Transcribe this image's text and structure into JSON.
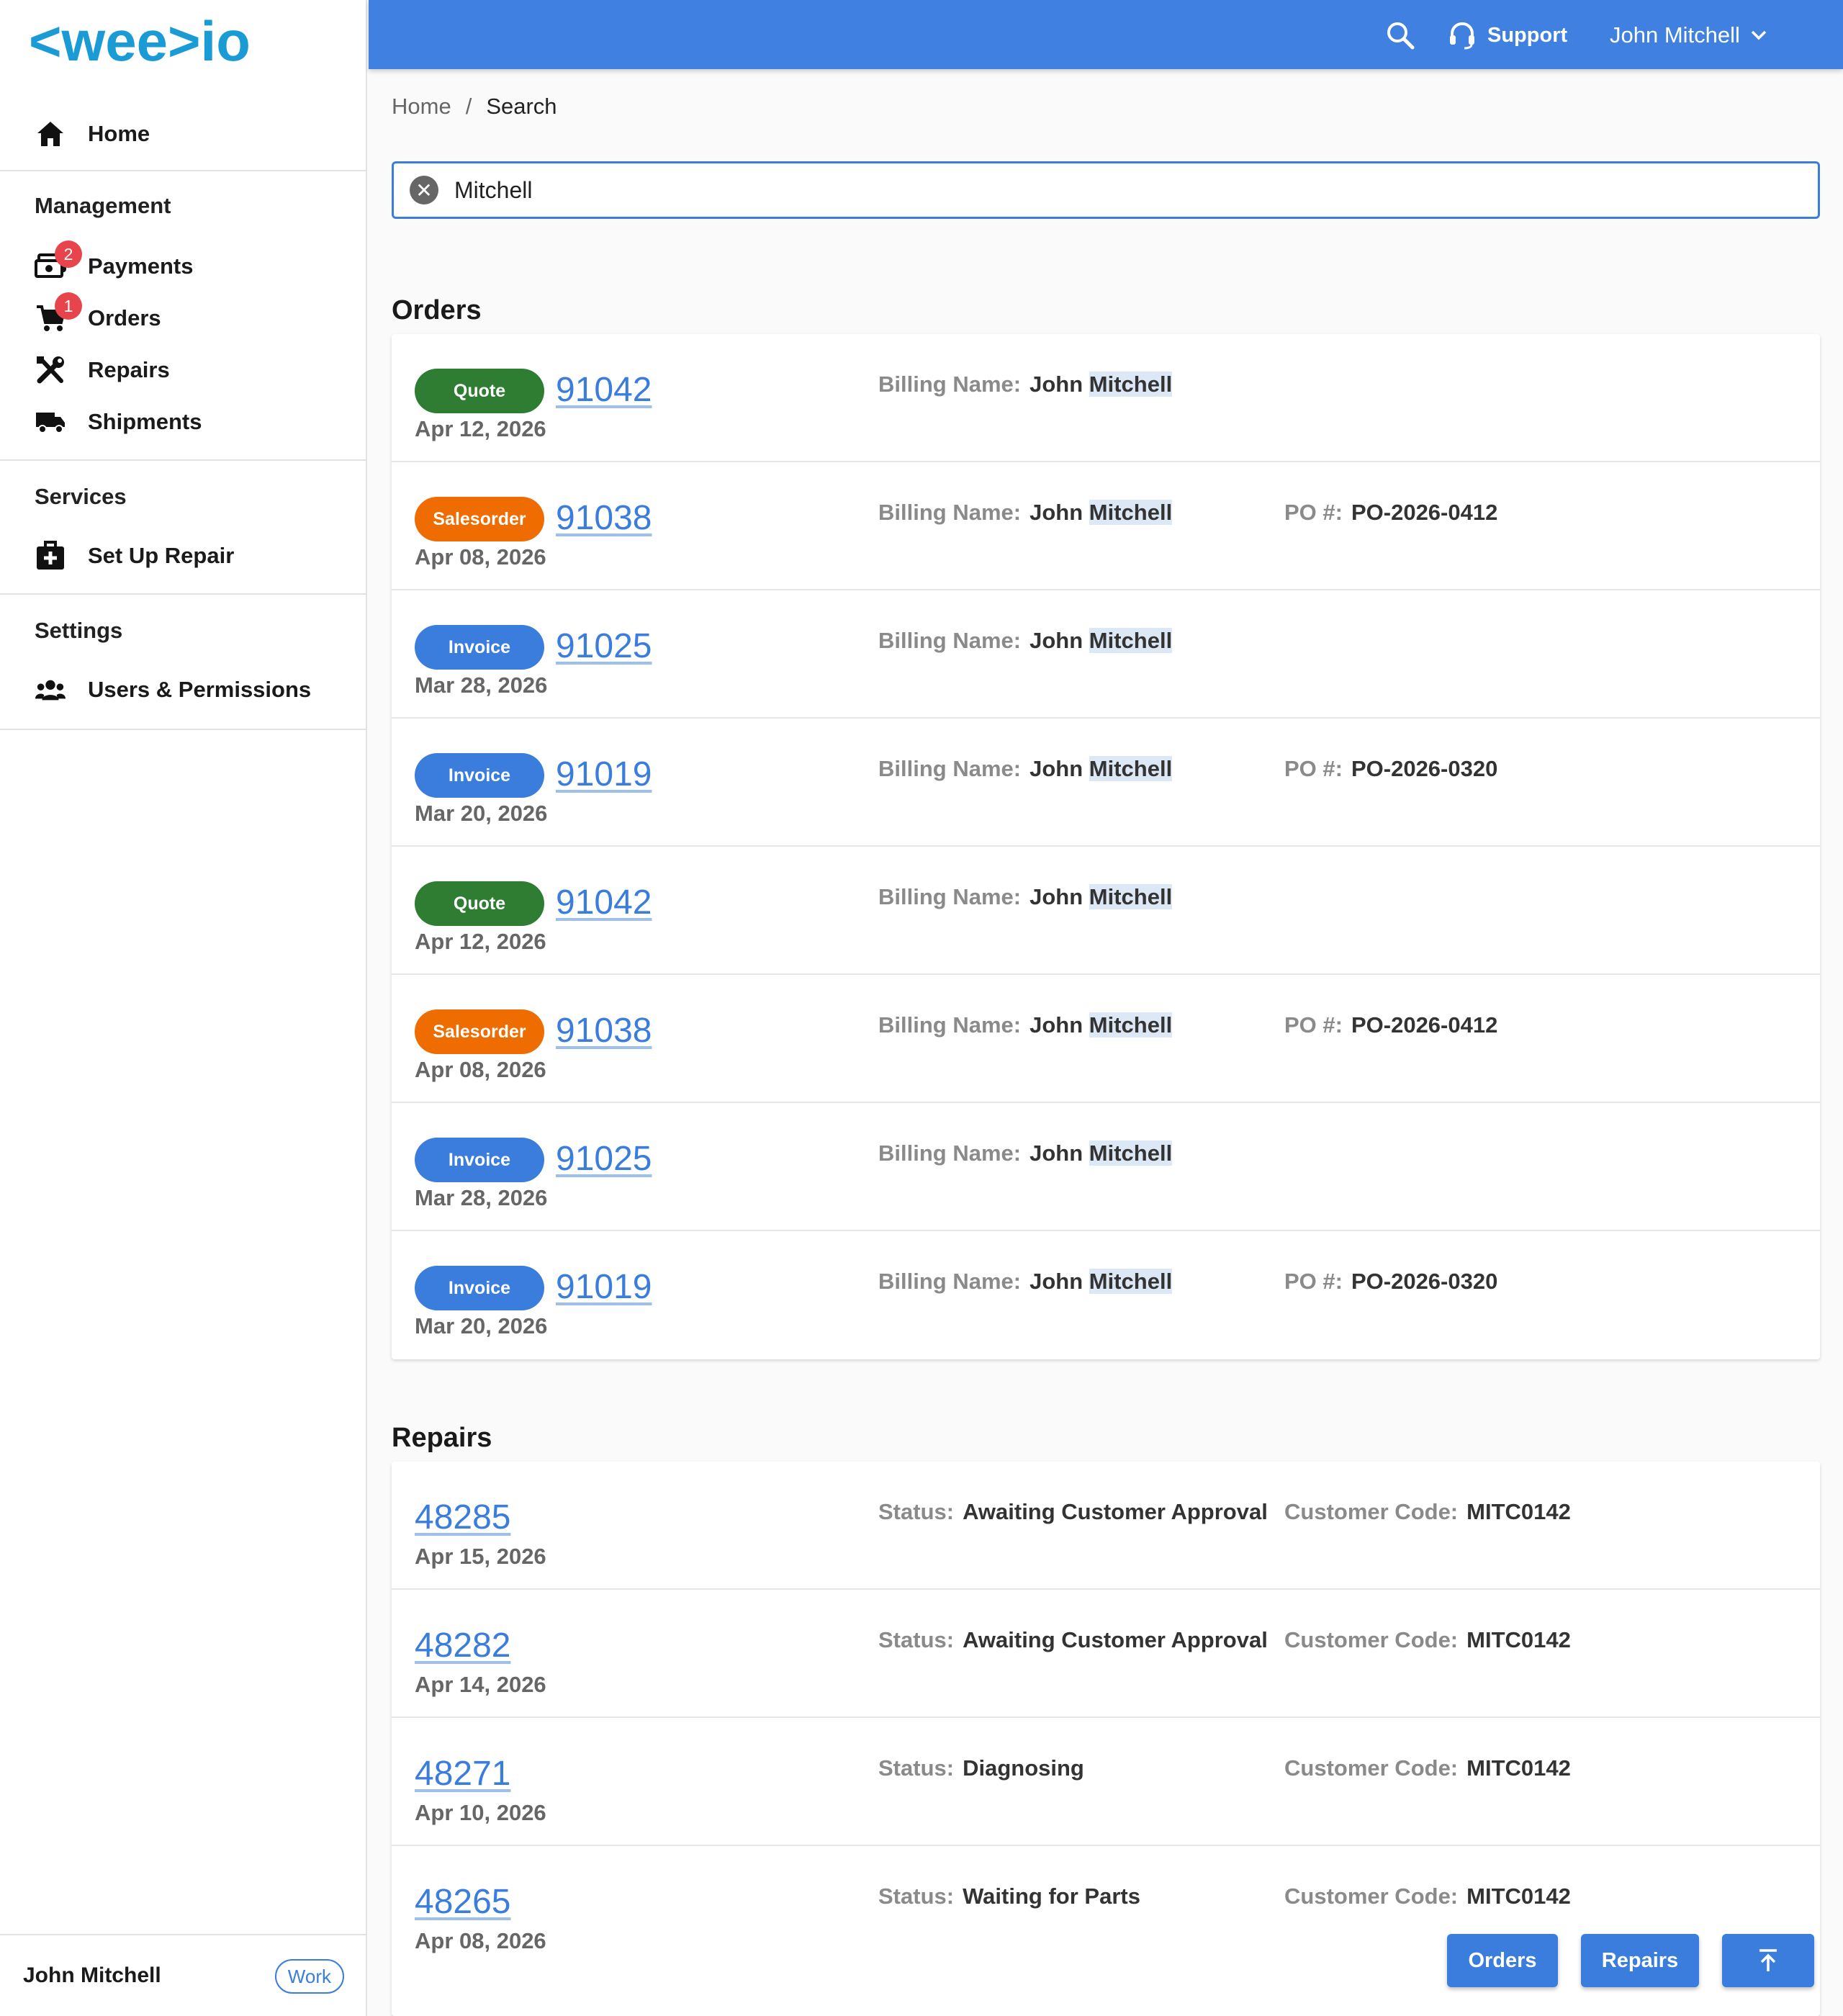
{
  "brand": {
    "logo_text": "<wee>io",
    "logo_color": "#1b9bd6"
  },
  "sidebar": {
    "home_label": "Home",
    "management_title": "Management",
    "management_items": [
      {
        "label": "Payments",
        "icon": "payments-icon",
        "badge": "2"
      },
      {
        "label": "Orders",
        "icon": "cart-icon",
        "badge": "1"
      },
      {
        "label": "Repairs",
        "icon": "tools-icon"
      },
      {
        "label": "Shipments",
        "icon": "truck-icon"
      }
    ],
    "services_title": "Services",
    "services_items": [
      {
        "label": "Set Up Repair",
        "icon": "medical-kit-icon"
      }
    ],
    "settings_title": "Settings",
    "settings_items": [
      {
        "label": "Users & Permissions",
        "icon": "users-icon"
      }
    ],
    "footer": {
      "name": "John Mitchell",
      "tag": "Work"
    }
  },
  "topbar": {
    "support_label": "Support",
    "user_name": "John Mitchell",
    "color": "#4080e0"
  },
  "breadcrumb": {
    "home": "Home",
    "separator": "/",
    "current": "Search"
  },
  "search": {
    "value": "Mitchell"
  },
  "orders": {
    "title": "Orders",
    "billing_label": "Billing Name:",
    "po_label": "PO #:",
    "rows": [
      {
        "type": "Quote",
        "number": "91042",
        "date": "Apr 12, 2026",
        "billing_first": "John",
        "billing_match": "Mitchell",
        "po": ""
      },
      {
        "type": "Salesorder",
        "number": "91038",
        "date": "Apr 08, 2026",
        "billing_first": "John",
        "billing_match": "Mitchell",
        "po": "PO-2026-0412"
      },
      {
        "type": "Invoice",
        "number": "91025",
        "date": "Mar 28, 2026",
        "billing_first": "John",
        "billing_match": "Mitchell",
        "po": ""
      },
      {
        "type": "Invoice",
        "number": "91019",
        "date": "Mar 20, 2026",
        "billing_first": "John",
        "billing_match": "Mitchell",
        "po": "PO-2026-0320"
      },
      {
        "type": "Quote",
        "number": "91042",
        "date": "Apr 12, 2026",
        "billing_first": "John",
        "billing_match": "Mitchell",
        "po": ""
      },
      {
        "type": "Salesorder",
        "number": "91038",
        "date": "Apr 08, 2026",
        "billing_first": "John",
        "billing_match": "Mitchell",
        "po": "PO-2026-0412"
      },
      {
        "type": "Invoice",
        "number": "91025",
        "date": "Mar 28, 2026",
        "billing_first": "John",
        "billing_match": "Mitchell",
        "po": ""
      },
      {
        "type": "Invoice",
        "number": "91019",
        "date": "Mar 20, 2026",
        "billing_first": "John",
        "billing_match": "Mitchell",
        "po": "PO-2026-0320"
      }
    ]
  },
  "repairs": {
    "title": "Repairs",
    "status_label": "Status:",
    "code_label": "Customer Code:",
    "rows": [
      {
        "number": "48285",
        "date": "Apr 15, 2026",
        "status": "Awaiting Customer Approval",
        "code": "MITC0142"
      },
      {
        "number": "48282",
        "date": "Apr 14, 2026",
        "status": "Awaiting Customer Approval",
        "code": "MITC0142"
      },
      {
        "number": "48271",
        "date": "Apr 10, 2026",
        "status": "Diagnosing",
        "code": "MITC0142"
      },
      {
        "number": "48265",
        "date": "Apr 08, 2026",
        "status": "Waiting for Parts",
        "code": "MITC0142"
      }
    ]
  },
  "fabs": {
    "orders_label": "Orders",
    "repairs_label": "Repairs",
    "top_icon": "arrow-to-top-icon"
  }
}
